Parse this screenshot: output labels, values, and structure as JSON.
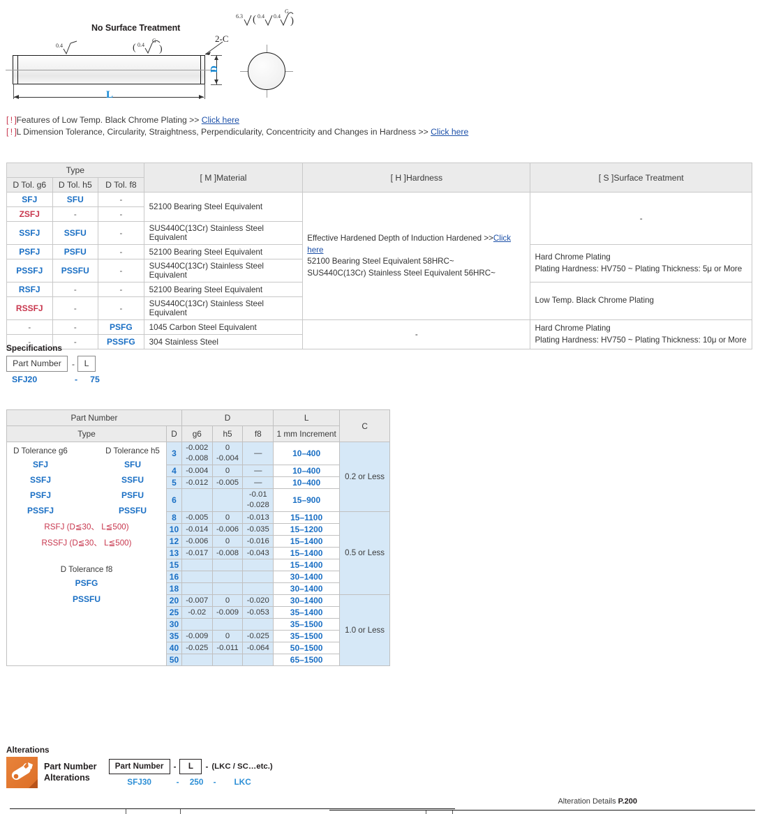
{
  "drawing": {
    "title": "No Surface Treatment",
    "label_L": "L",
    "label_D": "D",
    "label_chamfer": "2-C",
    "finish_top": "6.3/( 0.4/ 0.4/ G )",
    "finish_body_left": "0.4",
    "finish_body_right": "( 0.4 / G )"
  },
  "notes": [
    {
      "bang": "[ ! ]",
      "text": "Features of Low Temp. Black Chrome Plating >> ",
      "link": "Click here"
    },
    {
      "bang": "[ ! ]",
      "text": "L Dimension Tolerance, Circularity, Straightness, Perpendicularity, Concentricity and Changes in Hardness >> ",
      "link": "Click here"
    }
  ],
  "table1": {
    "headers": {
      "type": "Type",
      "g6": "D Tol. g6",
      "h5": "D Tol. h5",
      "f8": "D Tol. f8",
      "material": "[ M ]Material",
      "hardness": "[ H ]Hardness",
      "surface": "[ S ]Surface Treatment"
    },
    "rows": [
      {
        "g6": "SFJ",
        "g6_color": "blue",
        "h5": "SFU",
        "h5_color": "blue",
        "f8": "-",
        "material": "52100 Bearing Steel Equivalent"
      },
      {
        "g6": "ZSFJ",
        "g6_color": "red",
        "h5": "-",
        "h5_color": "dash",
        "f8": "-",
        "material": "52100 Bearing Steel Equivalent"
      },
      {
        "g6": "SSFJ",
        "g6_color": "blue",
        "h5": "SSFU",
        "h5_color": "blue",
        "f8": "-",
        "material": "SUS440C(13Cr) Stainless Steel Equivalent"
      },
      {
        "g6": "PSFJ",
        "g6_color": "blue",
        "h5": "PSFU",
        "h5_color": "blue",
        "f8": "-",
        "material": "52100 Bearing Steel Equivalent"
      },
      {
        "g6": "PSSFJ",
        "g6_color": "blue",
        "h5": "PSSFU",
        "h5_color": "blue",
        "f8": "-",
        "material": "SUS440C(13Cr) Stainless Steel Equivalent"
      },
      {
        "g6": "RSFJ",
        "g6_color": "blue",
        "h5": "-",
        "h5_color": "dash",
        "f8": "-",
        "material": "52100 Bearing Steel Equivalent"
      },
      {
        "g6": "RSSFJ",
        "g6_color": "red",
        "h5": "-",
        "h5_color": "dash",
        "f8": "-",
        "material": "SUS440C(13Cr) Stainless Steel Equivalent"
      },
      {
        "g6": "-",
        "g6_color": "dash",
        "h5": "-",
        "h5_color": "dash",
        "f8": "PSFG",
        "material": "1045 Carbon Steel Equivalent"
      },
      {
        "g6": "-",
        "g6_color": "dash",
        "h5": "-",
        "h5_color": "dash",
        "f8": "PSSFG",
        "material": "304 Stainless Steel"
      }
    ],
    "hardness_main_pre": "Effective Hardened Depth of Induction Hardened >>",
    "hardness_main_link": "Click here",
    "hardness_line2": "52100 Bearing Steel Equivalent 58HRC~",
    "hardness_line3": "SUS440C(13Cr) Stainless Steel Equivalent 56HRC~",
    "hardness_bottom": "-",
    "surface_none": "-",
    "surface_hard_l1": "Hard Chrome Plating",
    "surface_hard_l2": "Plating Hardness: HV750 ~ Plating Thickness: 5μ or More",
    "surface_black": "Low Temp. Black Chrome Plating",
    "surface_hard2_l1": "Hard Chrome Plating",
    "surface_hard2_l2": "Plating Hardness: HV750 ~ Plating Thickness: 10μ or More"
  },
  "specifications": {
    "title": "Specifications",
    "box_part_number": "Part Number",
    "box_L": "L",
    "dash": "-",
    "value_part_number": "SFJ20",
    "value_dash": "-",
    "value_L": "75"
  },
  "table2": {
    "headers": {
      "part_number": "Part Number",
      "type": "Type",
      "D_group": "D",
      "D": "D",
      "g6": "g6",
      "h5": "h5",
      "f8": "f8",
      "L": "L",
      "L_sub": "1 mm Increment",
      "C": "C"
    },
    "type_col": {
      "head_g6": "D Tolerance g6",
      "head_h5": "D Tolerance h5",
      "pairs": [
        {
          "g6": "SFJ",
          "h5": "SFU"
        },
        {
          "g6": "SSFJ",
          "h5": "SSFU"
        },
        {
          "g6": "PSFJ",
          "h5": "PSFU"
        },
        {
          "g6": "PSSFJ",
          "h5": "PSSFU"
        }
      ],
      "red_rows": [
        "RSFJ (D≦30、 L≦500)",
        "RSSFJ (D≦30、 L≦500)"
      ],
      "head_f8": "D Tolerance f8",
      "f8_rows": [
        "PSFG",
        "PSSFU"
      ]
    },
    "rows": [
      {
        "D": "3",
        "g6": [
          "-0.002",
          "-0.008"
        ],
        "h5": [
          "0",
          "-0.004"
        ],
        "f8": [
          "—"
        ],
        "L": "10–400"
      },
      {
        "D": "4",
        "g6": [
          "-0.004"
        ],
        "h5": [
          "0"
        ],
        "f8": [
          "—"
        ],
        "L": "10–400"
      },
      {
        "D": "5",
        "g6": [
          "-0.012"
        ],
        "h5": [
          "-0.005"
        ],
        "f8": [
          "—"
        ],
        "L": "10–400"
      },
      {
        "D": "6",
        "g6": [
          ""
        ],
        "h5": [
          ""
        ],
        "f8": [
          "-0.01",
          "-0.028"
        ],
        "L": "15–900"
      },
      {
        "D": "8",
        "g6": [
          "-0.005"
        ],
        "h5": [
          "0"
        ],
        "f8": [
          "-0.013"
        ],
        "L": "15–1100"
      },
      {
        "D": "10",
        "g6": [
          "-0.014"
        ],
        "h5": [
          "-0.006"
        ],
        "f8": [
          "-0.035"
        ],
        "L": "15–1200"
      },
      {
        "D": "12",
        "g6": [
          "-0.006"
        ],
        "h5": [
          "0"
        ],
        "f8": [
          "-0.016"
        ],
        "L": "15–1400"
      },
      {
        "D": "13",
        "g6": [
          "-0.017"
        ],
        "h5": [
          "-0.008"
        ],
        "f8": [
          "-0.043"
        ],
        "L": "15–1400"
      },
      {
        "D": "15",
        "g6": [
          ""
        ],
        "h5": [
          ""
        ],
        "f8": [
          ""
        ],
        "L": "15–1400"
      },
      {
        "D": "16",
        "g6": [
          ""
        ],
        "h5": [
          ""
        ],
        "f8": [
          ""
        ],
        "L": "30–1400"
      },
      {
        "D": "18",
        "g6": [
          ""
        ],
        "h5": [
          ""
        ],
        "f8": [
          ""
        ],
        "L": "30–1400"
      },
      {
        "D": "20",
        "g6": [
          "-0.007"
        ],
        "h5": [
          "0"
        ],
        "f8": [
          "-0.020"
        ],
        "L": "30–1400"
      },
      {
        "D": "25",
        "g6": [
          "-0.02"
        ],
        "h5": [
          "-0.009"
        ],
        "f8": [
          "-0.053"
        ],
        "L": "35–1400"
      },
      {
        "D": "30",
        "g6": [
          ""
        ],
        "h5": [
          ""
        ],
        "f8": [
          ""
        ],
        "L": "35–1500"
      },
      {
        "D": "35",
        "g6": [
          "-0.009"
        ],
        "h5": [
          "0"
        ],
        "f8": [
          "-0.025"
        ],
        "L": "35–1500"
      },
      {
        "D": "40",
        "g6": [
          "-0.025"
        ],
        "h5": [
          "-0.011"
        ],
        "f8": [
          "-0.064"
        ],
        "L": "50–1500"
      },
      {
        "D": "50",
        "g6": [
          ""
        ],
        "h5": [
          ""
        ],
        "f8": [
          ""
        ],
        "L": "65–1500"
      }
    ],
    "c_values": [
      "0.2 or Less",
      "0.5 or Less",
      "1.0 or Less"
    ]
  },
  "alterations": {
    "title": "Alterations",
    "icon_label_l1": "Part Number",
    "icon_label_l2": "Alterations",
    "box_part_number": "Part Number",
    "box_L": "L",
    "dash": "-",
    "suffix": "(LKC / SC…etc.)",
    "value_part_number": "SFJ30",
    "value_dash1": "-",
    "value_L": "250",
    "value_dash2": "-",
    "value_code": "LKC",
    "details_text": "Alteration Details ",
    "details_page": "P.200"
  },
  "colors": {
    "blue_text": "#1a6fc4",
    "red_text": "#c8374e",
    "link": "#1b4fa8",
    "cell_highlight": "#d6e8f7",
    "header_gray": "#ebebeb",
    "accent_cyan": "#0b84d4",
    "icon_orange": "#dd6f28"
  }
}
